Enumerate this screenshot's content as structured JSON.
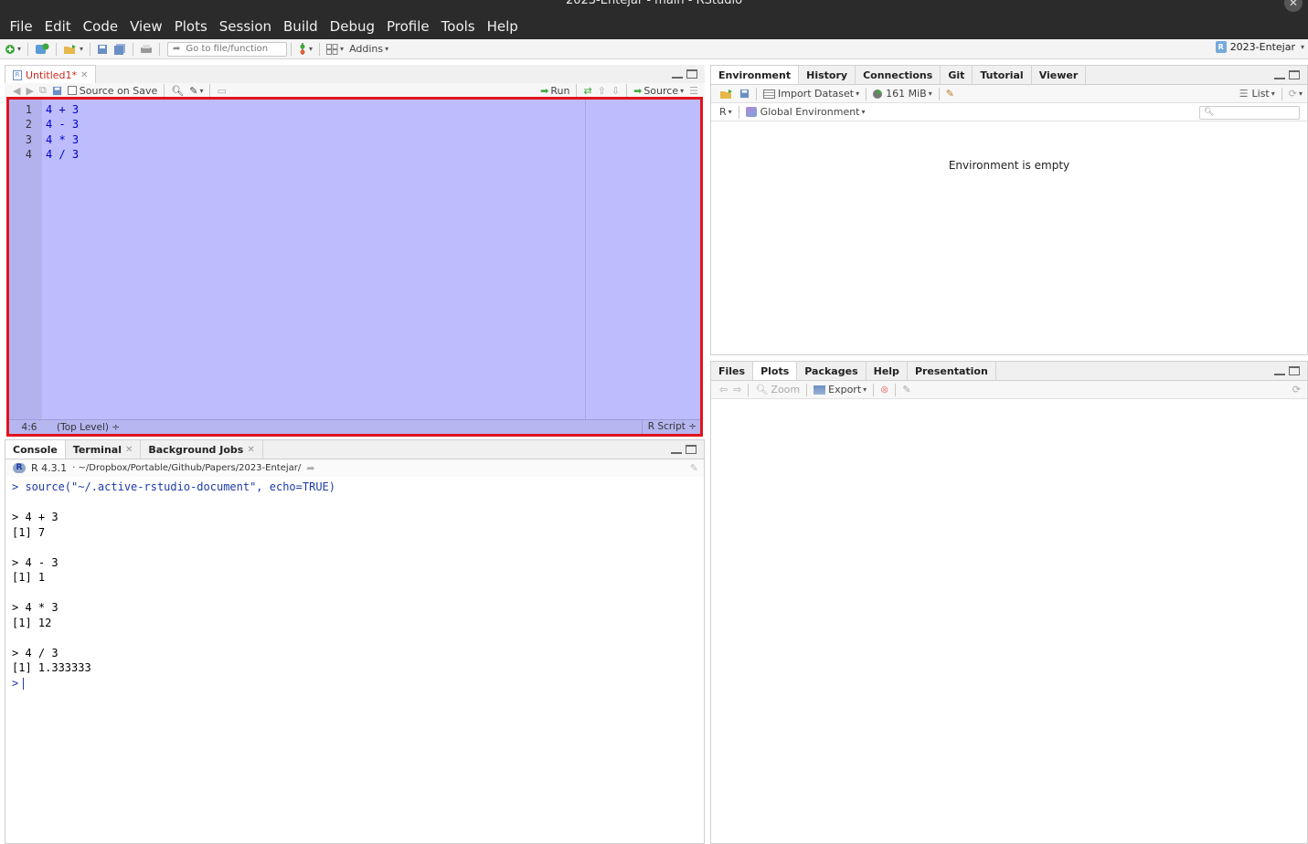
{
  "window": {
    "title": "2023-Entejar - main - RStudio"
  },
  "menu": [
    "File",
    "Edit",
    "Code",
    "View",
    "Plots",
    "Session",
    "Build",
    "Debug",
    "Profile",
    "Tools",
    "Help"
  ],
  "toolbar": {
    "goto_placeholder": "Go to file/function",
    "addins_label": "Addins",
    "project_label": "2023-Entejar"
  },
  "source": {
    "tab_label": "Untitled1*",
    "source_on_save_label": "Source on Save",
    "run_label": "Run",
    "source_label": "Source",
    "line_numbers": [
      "1",
      "2",
      "3",
      "4"
    ],
    "code_lines": [
      "4 + 3",
      "4 - 3",
      "4 * 3",
      "4 / 3"
    ],
    "cursor_position": "4:6",
    "scope": "(Top Level) ÷",
    "file_type": "R Script ÷"
  },
  "console": {
    "tabs": [
      {
        "label": "Console"
      },
      {
        "label": "Terminal"
      },
      {
        "label": "Background Jobs"
      }
    ],
    "r_version": "R 4.3.1",
    "path": "· ~/Dropbox/Portable/Github/Papers/2023-Entejar/",
    "source_cmd": "> source(\"~/.active-rstudio-document\", echo=TRUE)",
    "lines": [
      "> 4 + 3",
      "[1] 7",
      "> 4 - 3",
      "[1] 1",
      "> 4 * 3",
      "[1] 12",
      "> 4 / 3",
      "[1] 1.333333"
    ],
    "prompt": ">"
  },
  "environment": {
    "tabs": [
      "Environment",
      "History",
      "Connections",
      "Git",
      "Tutorial",
      "Viewer"
    ],
    "import_label": "Import Dataset",
    "memory_label": "161 MiB",
    "list_label": "List",
    "lang_label": "R",
    "global_env_label": "Global Environment",
    "empty_message": "Environment is empty"
  },
  "files": {
    "tabs": [
      "Files",
      "Plots",
      "Packages",
      "Help",
      "Presentation"
    ],
    "zoom_label": "Zoom",
    "export_label": "Export"
  }
}
